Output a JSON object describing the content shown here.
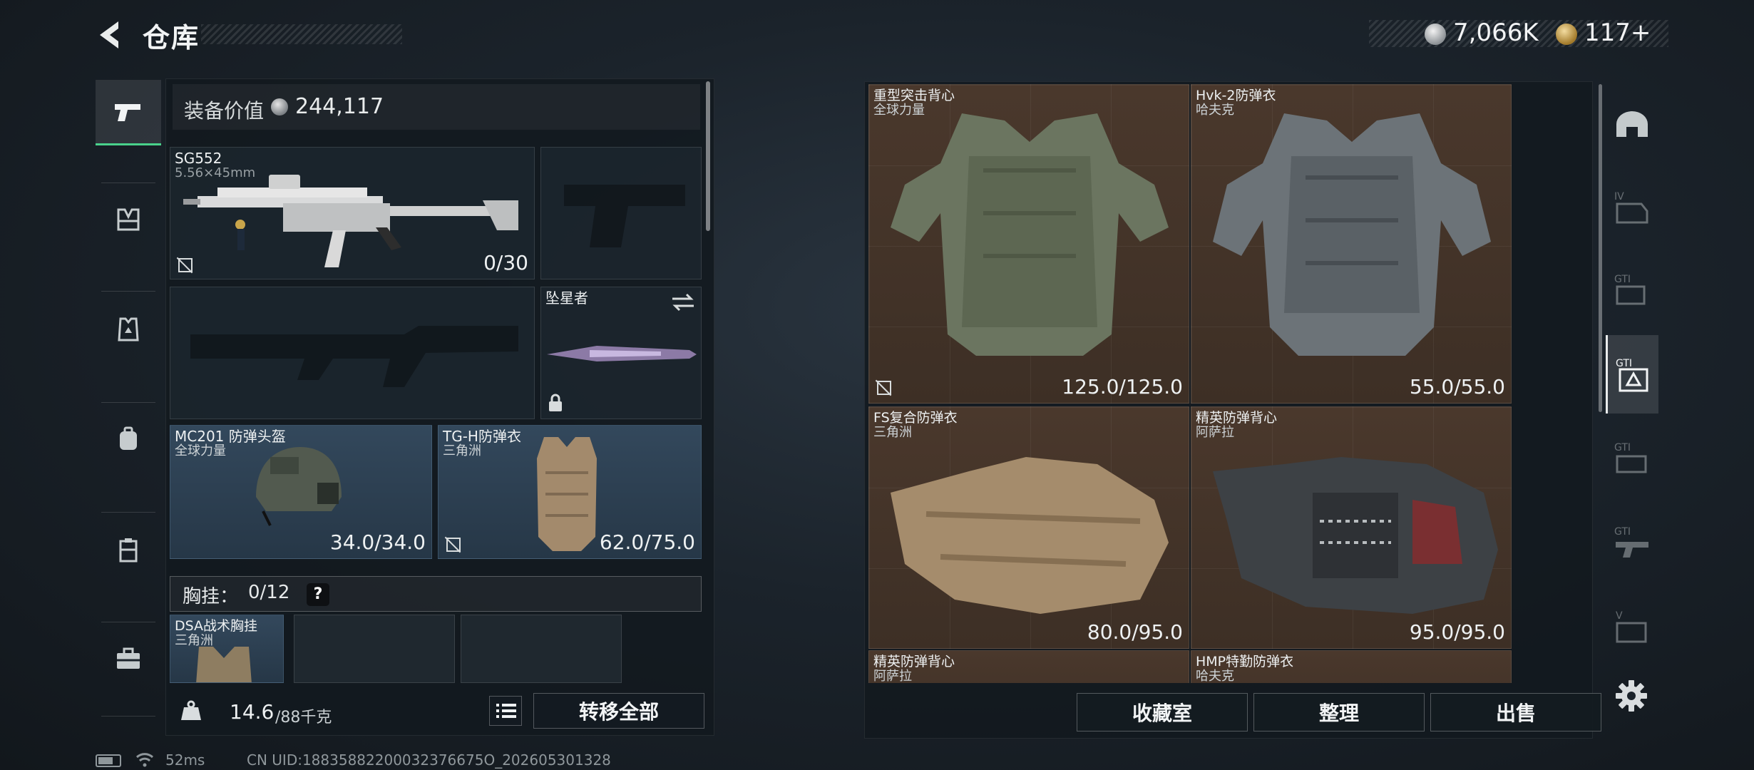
{
  "header": {
    "title": "仓库",
    "currency": [
      {
        "name": "silver-coin",
        "value": "7,066K"
      },
      {
        "name": "gold-coin",
        "value": "117+"
      }
    ]
  },
  "left_nav": {
    "items": [
      {
        "icon": "pistol-icon",
        "active": true
      },
      {
        "icon": "chest-rig-icon",
        "active": false
      },
      {
        "icon": "armor-icon",
        "active": false
      },
      {
        "icon": "backpack-icon",
        "active": false
      },
      {
        "icon": "container-icon",
        "active": false
      },
      {
        "icon": "briefcase-icon",
        "active": false
      }
    ]
  },
  "loadout": {
    "value_label": "装备价值",
    "value_amount": "244,117",
    "slots": {
      "primary": {
        "name": "SG552",
        "caliber": "5.56×45mm",
        "ammo": "0/30"
      },
      "melee": {
        "name": "坠星者"
      },
      "helmet": {
        "name": "MC201 防弹头盔",
        "maker": "全球力量",
        "durability": "34.0/34.0"
      },
      "armor": {
        "name": "TG-H防弹衣",
        "maker": "三角洲",
        "durability": "62.0/75.0"
      }
    },
    "chest_rig": {
      "label": "胸挂：",
      "count": "0/12",
      "help": "?"
    },
    "chest_rig_item": {
      "name": "DSA战术胸挂",
      "maker": "三角洲"
    },
    "weight_current": "14.6",
    "weight_max": "/88千克",
    "transfer_all_label": "转移全部"
  },
  "storage": {
    "items": [
      {
        "name": "重型突击背心",
        "maker": "全球力量",
        "durability": "125.0/125.0"
      },
      {
        "name": "Hvk-2防弹衣",
        "maker": "哈夫克",
        "durability": "55.0/55.0"
      },
      {
        "name": "FS复合防弹衣",
        "maker": "三角洲",
        "durability": "80.0/95.0"
      },
      {
        "name": "精英防弹背心",
        "maker": "阿萨拉",
        "durability": "95.0/95.0"
      },
      {
        "name": "精英防弹背心",
        "maker": "阿萨拉",
        "durability": ""
      },
      {
        "name": "HMP特勤防弹衣",
        "maker": "哈夫克",
        "durability": ""
      }
    ],
    "buttons": {
      "collection": "收藏室",
      "sort": "整理",
      "sell": "出售"
    }
  },
  "right_rail": {
    "items": [
      {
        "icon": "helmet-filter-icon",
        "active": false
      },
      {
        "icon": "helmet-level-filter-icon",
        "badge": "IV",
        "active": false
      },
      {
        "icon": "gti-helmet-filter-icon",
        "badge": "GTI",
        "active": false
      },
      {
        "icon": "gti-armor-filter-icon",
        "badge": "GTI",
        "active": true
      },
      {
        "icon": "gti-rig-filter-icon",
        "badge": "GTI",
        "active": false
      },
      {
        "icon": "gti-weapon-filter-icon",
        "badge": "GTI",
        "active": false
      },
      {
        "icon": "v-filter-icon",
        "badge": "V",
        "active": false
      }
    ]
  },
  "status": {
    "ping": "52ms",
    "uid": "CN UID:18835882200032376675O_202605301328"
  },
  "colors": {
    "accent_green": "#49d18b",
    "storage_cell": "#4a382c",
    "equipped_slot": "#33485c"
  }
}
